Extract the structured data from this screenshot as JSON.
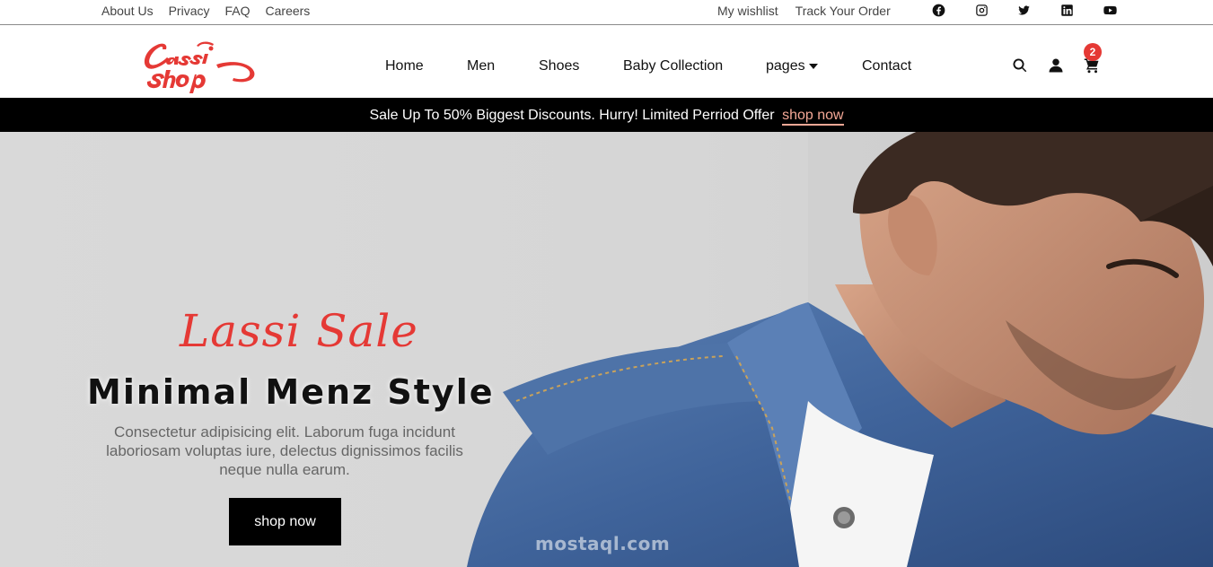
{
  "topbar": {
    "left_links": [
      "About Us",
      "Privacy",
      "FAQ",
      "Careers"
    ],
    "right_links": [
      "My wishlist",
      "Track Your Order"
    ],
    "social": [
      "facebook-icon",
      "instagram-icon",
      "twitter-icon",
      "linkedin-icon",
      "youtube-icon"
    ]
  },
  "brand": {
    "logo_text": "Lassi Shop",
    "accent": "#e53935"
  },
  "nav": {
    "items": [
      "Home",
      "Men",
      "Shoes",
      "Baby Collection",
      "pages",
      "Contact"
    ],
    "cart_count": "2"
  },
  "announcement": {
    "text": "Sale Up To 50% Biggest Discounts. Hurry! Limited Perriod Offer",
    "link": "shop now"
  },
  "hero": {
    "script_title": "Lassi Sale",
    "title": "Minimal Menz Style",
    "description": "Consectetur adipisicing elit. Laborum fuga incidunt laboriosam voluptas iure, delectus dignissimos facilis neque nulla earum.",
    "button": "shop now",
    "watermark": "mostaql.com"
  }
}
